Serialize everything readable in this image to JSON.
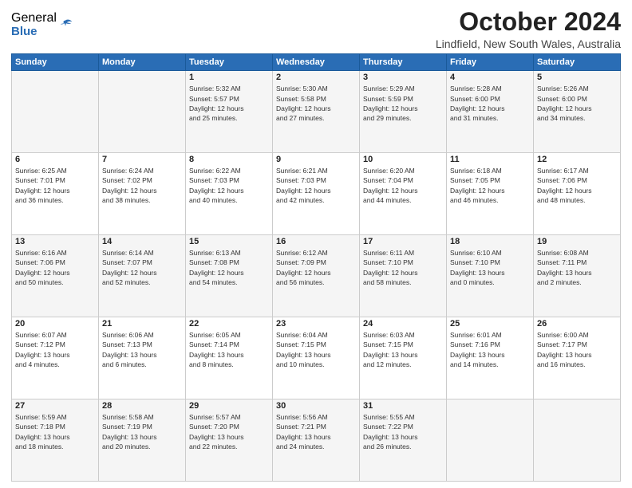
{
  "logo": {
    "general": "General",
    "blue": "Blue"
  },
  "header": {
    "month": "October 2024",
    "location": "Lindfield, New South Wales, Australia"
  },
  "weekdays": [
    "Sunday",
    "Monday",
    "Tuesday",
    "Wednesday",
    "Thursday",
    "Friday",
    "Saturday"
  ],
  "weeks": [
    [
      {
        "day": "",
        "info": ""
      },
      {
        "day": "",
        "info": ""
      },
      {
        "day": "1",
        "info": "Sunrise: 5:32 AM\nSunset: 5:57 PM\nDaylight: 12 hours\nand 25 minutes."
      },
      {
        "day": "2",
        "info": "Sunrise: 5:30 AM\nSunset: 5:58 PM\nDaylight: 12 hours\nand 27 minutes."
      },
      {
        "day": "3",
        "info": "Sunrise: 5:29 AM\nSunset: 5:59 PM\nDaylight: 12 hours\nand 29 minutes."
      },
      {
        "day": "4",
        "info": "Sunrise: 5:28 AM\nSunset: 6:00 PM\nDaylight: 12 hours\nand 31 minutes."
      },
      {
        "day": "5",
        "info": "Sunrise: 5:26 AM\nSunset: 6:00 PM\nDaylight: 12 hours\nand 34 minutes."
      }
    ],
    [
      {
        "day": "6",
        "info": "Sunrise: 6:25 AM\nSunset: 7:01 PM\nDaylight: 12 hours\nand 36 minutes."
      },
      {
        "day": "7",
        "info": "Sunrise: 6:24 AM\nSunset: 7:02 PM\nDaylight: 12 hours\nand 38 minutes."
      },
      {
        "day": "8",
        "info": "Sunrise: 6:22 AM\nSunset: 7:03 PM\nDaylight: 12 hours\nand 40 minutes."
      },
      {
        "day": "9",
        "info": "Sunrise: 6:21 AM\nSunset: 7:03 PM\nDaylight: 12 hours\nand 42 minutes."
      },
      {
        "day": "10",
        "info": "Sunrise: 6:20 AM\nSunset: 7:04 PM\nDaylight: 12 hours\nand 44 minutes."
      },
      {
        "day": "11",
        "info": "Sunrise: 6:18 AM\nSunset: 7:05 PM\nDaylight: 12 hours\nand 46 minutes."
      },
      {
        "day": "12",
        "info": "Sunrise: 6:17 AM\nSunset: 7:06 PM\nDaylight: 12 hours\nand 48 minutes."
      }
    ],
    [
      {
        "day": "13",
        "info": "Sunrise: 6:16 AM\nSunset: 7:06 PM\nDaylight: 12 hours\nand 50 minutes."
      },
      {
        "day": "14",
        "info": "Sunrise: 6:14 AM\nSunset: 7:07 PM\nDaylight: 12 hours\nand 52 minutes."
      },
      {
        "day": "15",
        "info": "Sunrise: 6:13 AM\nSunset: 7:08 PM\nDaylight: 12 hours\nand 54 minutes."
      },
      {
        "day": "16",
        "info": "Sunrise: 6:12 AM\nSunset: 7:09 PM\nDaylight: 12 hours\nand 56 minutes."
      },
      {
        "day": "17",
        "info": "Sunrise: 6:11 AM\nSunset: 7:10 PM\nDaylight: 12 hours\nand 58 minutes."
      },
      {
        "day": "18",
        "info": "Sunrise: 6:10 AM\nSunset: 7:10 PM\nDaylight: 13 hours\nand 0 minutes."
      },
      {
        "day": "19",
        "info": "Sunrise: 6:08 AM\nSunset: 7:11 PM\nDaylight: 13 hours\nand 2 minutes."
      }
    ],
    [
      {
        "day": "20",
        "info": "Sunrise: 6:07 AM\nSunset: 7:12 PM\nDaylight: 13 hours\nand 4 minutes."
      },
      {
        "day": "21",
        "info": "Sunrise: 6:06 AM\nSunset: 7:13 PM\nDaylight: 13 hours\nand 6 minutes."
      },
      {
        "day": "22",
        "info": "Sunrise: 6:05 AM\nSunset: 7:14 PM\nDaylight: 13 hours\nand 8 minutes."
      },
      {
        "day": "23",
        "info": "Sunrise: 6:04 AM\nSunset: 7:15 PM\nDaylight: 13 hours\nand 10 minutes."
      },
      {
        "day": "24",
        "info": "Sunrise: 6:03 AM\nSunset: 7:15 PM\nDaylight: 13 hours\nand 12 minutes."
      },
      {
        "day": "25",
        "info": "Sunrise: 6:01 AM\nSunset: 7:16 PM\nDaylight: 13 hours\nand 14 minutes."
      },
      {
        "day": "26",
        "info": "Sunrise: 6:00 AM\nSunset: 7:17 PM\nDaylight: 13 hours\nand 16 minutes."
      }
    ],
    [
      {
        "day": "27",
        "info": "Sunrise: 5:59 AM\nSunset: 7:18 PM\nDaylight: 13 hours\nand 18 minutes."
      },
      {
        "day": "28",
        "info": "Sunrise: 5:58 AM\nSunset: 7:19 PM\nDaylight: 13 hours\nand 20 minutes."
      },
      {
        "day": "29",
        "info": "Sunrise: 5:57 AM\nSunset: 7:20 PM\nDaylight: 13 hours\nand 22 minutes."
      },
      {
        "day": "30",
        "info": "Sunrise: 5:56 AM\nSunset: 7:21 PM\nDaylight: 13 hours\nand 24 minutes."
      },
      {
        "day": "31",
        "info": "Sunrise: 5:55 AM\nSunset: 7:22 PM\nDaylight: 13 hours\nand 26 minutes."
      },
      {
        "day": "",
        "info": ""
      },
      {
        "day": "",
        "info": ""
      }
    ]
  ]
}
